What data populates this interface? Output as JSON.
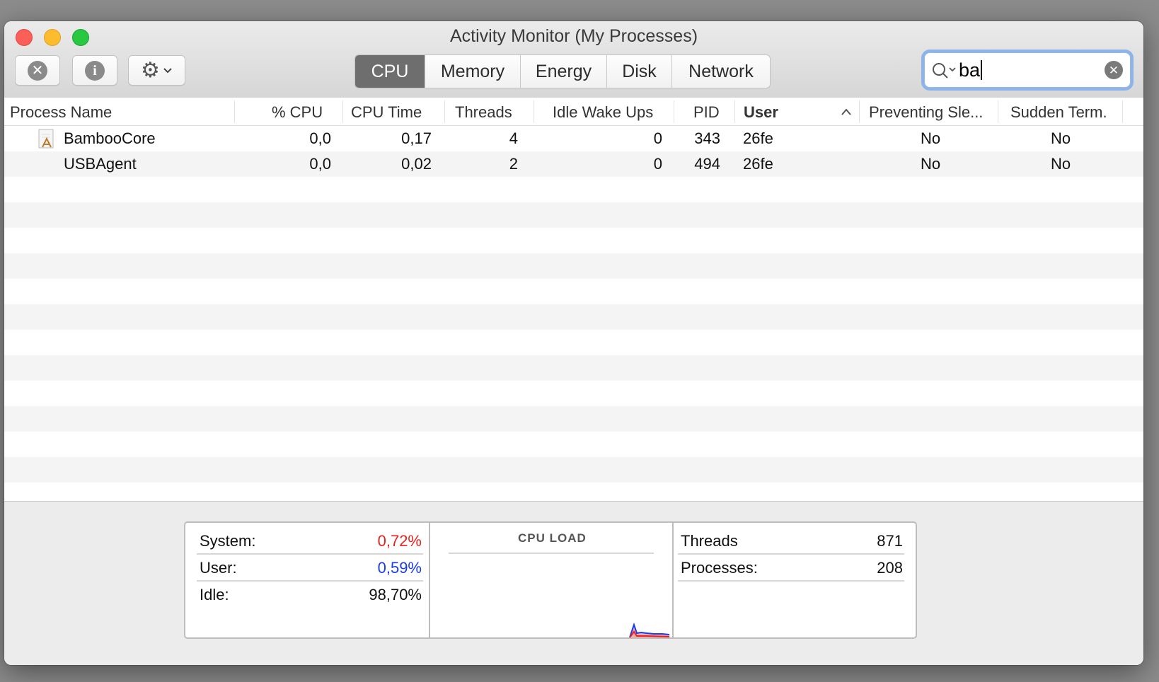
{
  "window": {
    "title": "Activity Monitor (My Processes)"
  },
  "toolbar": {
    "stop_icon": "x-circle-icon",
    "info_icon": "info-icon",
    "gear_icon": "gear-icon"
  },
  "tabs": [
    {
      "label": "CPU",
      "active": true
    },
    {
      "label": "Memory",
      "active": false
    },
    {
      "label": "Energy",
      "active": false
    },
    {
      "label": "Disk",
      "active": false
    },
    {
      "label": "Network",
      "active": false
    }
  ],
  "search": {
    "value": "ba"
  },
  "table": {
    "columns": [
      "Process Name",
      "% CPU",
      "CPU Time",
      "Threads",
      "Idle Wake Ups",
      "PID",
      "User",
      "Preventing Sle...",
      "Sudden Term."
    ],
    "sorted_column": "User",
    "sort_direction": "ascending",
    "rows": [
      {
        "name": "BambooCore",
        "cpu": "0,0",
        "cpu_time": "0,17",
        "threads": "4",
        "idle_wake_ups": "0",
        "pid": "343",
        "user": "26fe",
        "preventing_sleep": "No",
        "sudden_term": "No"
      },
      {
        "name": "USBAgent",
        "cpu": "0,0",
        "cpu_time": "0,02",
        "threads": "2",
        "idle_wake_ups": "0",
        "pid": "494",
        "user": "26fe",
        "preventing_sleep": "No",
        "sudden_term": "No"
      }
    ]
  },
  "stats": {
    "system_label": "System:",
    "system_value": "0,72%",
    "user_label": "User:",
    "user_value": "0,59%",
    "idle_label": "Idle:",
    "idle_value": "98,70%",
    "graph_title": "CPU LOAD",
    "threads_label": "Threads",
    "threads_value": "871",
    "processes_label": "Processes:",
    "processes_value": "208"
  },
  "colors": {
    "system": "#e8231f",
    "user": "#1a3cf0",
    "active_tab": "#6e6e6e"
  }
}
